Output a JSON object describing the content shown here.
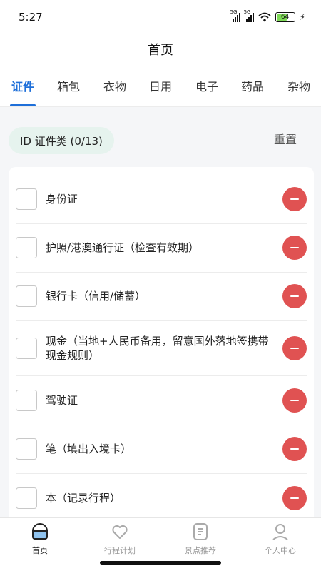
{
  "status_bar": {
    "time": "5:27",
    "network_1": "5G",
    "network_2": "5G",
    "battery": "64",
    "icons": [
      "signal-icon",
      "signal-icon",
      "wifi-icon",
      "battery-icon",
      "charging-icon"
    ]
  },
  "header": {
    "title": "首页"
  },
  "tabs": [
    {
      "label": "证件",
      "active": true
    },
    {
      "label": "箱包"
    },
    {
      "label": "衣物"
    },
    {
      "label": "日用"
    },
    {
      "label": "电子"
    },
    {
      "label": "药品"
    },
    {
      "label": "杂物"
    }
  ],
  "category": {
    "chip_label": "ID  证件类 (0/13)",
    "checked": 0,
    "total": 13
  },
  "reset_label": "重置",
  "items": [
    {
      "label": "身份证",
      "checked": false
    },
    {
      "label": "护照/港澳通行证（检查有效期）",
      "checked": false
    },
    {
      "label": "银行卡（信用/储蓄）",
      "checked": false
    },
    {
      "label": "现金（当地+人民币备用，留意国外落地签携带现金规则）",
      "checked": false
    },
    {
      "label": "驾驶证",
      "checked": false
    },
    {
      "label": "笔（填出入境卡）",
      "checked": false
    },
    {
      "label": "本（记录行程）",
      "checked": false
    }
  ],
  "bottom_nav": [
    {
      "label": "首页",
      "icon": "home-icon",
      "active": true
    },
    {
      "label": "行程计划",
      "icon": "heart-icon"
    },
    {
      "label": "景点推荐",
      "icon": "document-icon"
    },
    {
      "label": "个人中心",
      "icon": "person-icon"
    }
  ],
  "colors": {
    "accent": "#1e6fd9",
    "remove": "#e05252",
    "chip_bg": "#e6f3ee",
    "battery_fill": "#7ed957"
  }
}
